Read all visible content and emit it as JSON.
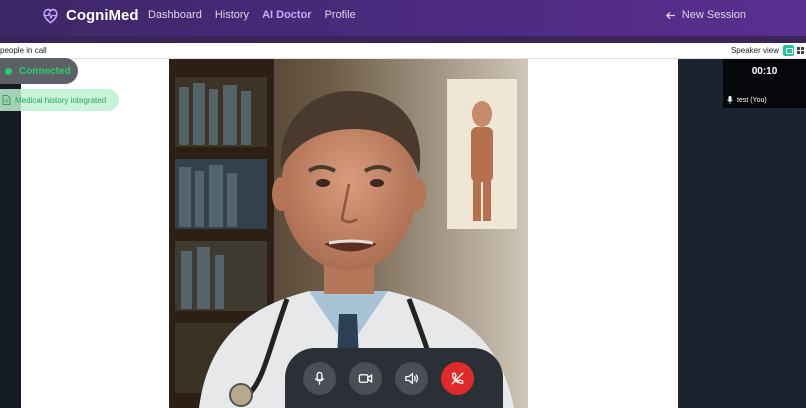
{
  "brand": {
    "name": "CogniMed"
  },
  "nav": {
    "items": [
      {
        "label": "Dashboard",
        "active": false
      },
      {
        "label": "History",
        "active": false
      },
      {
        "label": "AI Doctor",
        "active": true
      },
      {
        "label": "Profile",
        "active": false
      }
    ],
    "new_session_label": "New Session"
  },
  "call": {
    "people_label": "people in call",
    "view_label": "Speaker view",
    "status_label": "Connected",
    "history_label": "Medical history integrated",
    "timer": "00:10",
    "self_name": "test (You)"
  },
  "colors": {
    "accent": "#c9a6ff",
    "connected": "#27d06b",
    "end_call": "#e02a2a",
    "toggle": "#24c4a0"
  },
  "icons": {
    "logo": "heart-pulse-icon",
    "back": "arrow-left-icon",
    "doc": "document-icon",
    "mic": "microphone-icon",
    "cam": "video-camera-icon",
    "vol": "speaker-icon",
    "end": "phone-off-icon"
  }
}
